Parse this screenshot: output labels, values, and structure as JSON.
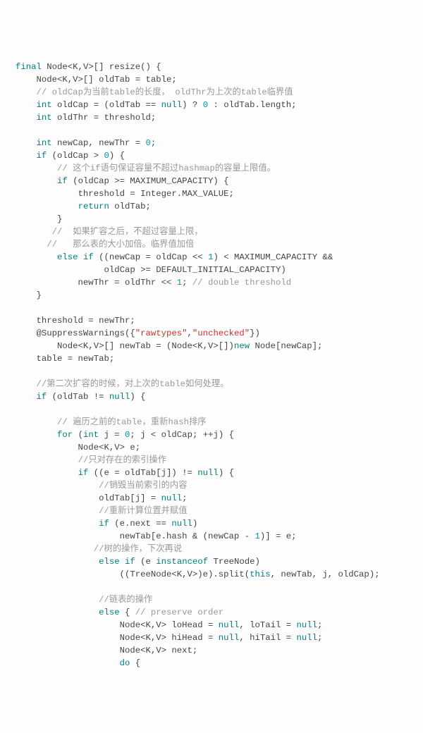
{
  "code": {
    "tokens": [
      [
        [
          "k",
          "final"
        ],
        [
          "p",
          " Node<K,V>[] resize() {"
        ]
      ],
      [
        [
          "p",
          "    Node<K,V>[] oldTab = table;"
        ]
      ],
      [
        [
          "p",
          "    "
        ],
        [
          "c",
          "// oldCap为当前table的长度， oldThr为上次的table临界值"
        ]
      ],
      [
        [
          "p",
          "    "
        ],
        [
          "k",
          "int"
        ],
        [
          "p",
          " oldCap = (oldTab == "
        ],
        [
          "b",
          "null"
        ],
        [
          "p",
          ") ? "
        ],
        [
          "n",
          "0"
        ],
        [
          "p",
          " : oldTab.length;"
        ]
      ],
      [
        [
          "p",
          "    "
        ],
        [
          "k",
          "int"
        ],
        [
          "p",
          " oldThr = threshold;"
        ]
      ],
      [
        [
          "p",
          ""
        ]
      ],
      [
        [
          "p",
          "    "
        ],
        [
          "k",
          "int"
        ],
        [
          "p",
          " newCap, newThr = "
        ],
        [
          "n",
          "0"
        ],
        [
          "p",
          ";"
        ]
      ],
      [
        [
          "p",
          "    "
        ],
        [
          "k",
          "if"
        ],
        [
          "p",
          " (oldCap > "
        ],
        [
          "n",
          "0"
        ],
        [
          "p",
          ") {"
        ]
      ],
      [
        [
          "p",
          "        "
        ],
        [
          "c",
          "// 这个if语句保证容量不超过hashmap的容量上限值。"
        ]
      ],
      [
        [
          "p",
          "        "
        ],
        [
          "k",
          "if"
        ],
        [
          "p",
          " (oldCap >= MAXIMUM_CAPACITY) {"
        ]
      ],
      [
        [
          "p",
          "            threshold = Integer.MAX_VALUE;"
        ]
      ],
      [
        [
          "p",
          "            "
        ],
        [
          "k",
          "return"
        ],
        [
          "p",
          " oldTab;"
        ]
      ],
      [
        [
          "p",
          "        }"
        ]
      ],
      [
        [
          "p",
          "       "
        ],
        [
          "c",
          "//  如果扩容之后，不超过容量上限，"
        ]
      ],
      [
        [
          "p",
          "      "
        ],
        [
          "c",
          "//   那么表的大小加倍。临界值加倍"
        ]
      ],
      [
        [
          "p",
          "        "
        ],
        [
          "k",
          "else"
        ],
        [
          "p",
          " "
        ],
        [
          "k",
          "if"
        ],
        [
          "p",
          " ((newCap = oldCap << "
        ],
        [
          "n",
          "1"
        ],
        [
          "p",
          ") < MAXIMUM_CAPACITY &&"
        ]
      ],
      [
        [
          "p",
          "                 oldCap >= DEFAULT_INITIAL_CAPACITY)"
        ]
      ],
      [
        [
          "p",
          "            newThr = oldThr << "
        ],
        [
          "n",
          "1"
        ],
        [
          "p",
          "; "
        ],
        [
          "c",
          "// double threshold"
        ]
      ],
      [
        [
          "p",
          "    }"
        ]
      ],
      [
        [
          "p",
          ""
        ]
      ],
      [
        [
          "p",
          "    threshold = newThr;"
        ]
      ],
      [
        [
          "p",
          "    @SuppressWarnings({"
        ],
        [
          "s",
          "\"rawtypes\""
        ],
        [
          "p",
          ","
        ],
        [
          "s",
          "\"unchecked\""
        ],
        [
          "p",
          "})"
        ]
      ],
      [
        [
          "p",
          "        Node<K,V>[] newTab = (Node<K,V>[])"
        ],
        [
          "k",
          "new"
        ],
        [
          "p",
          " Node[newCap];"
        ]
      ],
      [
        [
          "p",
          "    table = newTab;"
        ]
      ],
      [
        [
          "p",
          ""
        ]
      ],
      [
        [
          "p",
          "    "
        ],
        [
          "c",
          "//第二次扩容的时候，对上次的table如何处理。"
        ]
      ],
      [
        [
          "p",
          "    "
        ],
        [
          "k",
          "if"
        ],
        [
          "p",
          " (oldTab != "
        ],
        [
          "b",
          "null"
        ],
        [
          "p",
          ") {"
        ]
      ],
      [
        [
          "p",
          ""
        ]
      ],
      [
        [
          "p",
          "        "
        ],
        [
          "c",
          "// 遍历之前的table，重新hash排序"
        ]
      ],
      [
        [
          "p",
          "        "
        ],
        [
          "k",
          "for"
        ],
        [
          "p",
          " ("
        ],
        [
          "k",
          "int"
        ],
        [
          "p",
          " j = "
        ],
        [
          "n",
          "0"
        ],
        [
          "p",
          "; j < oldCap; ++j) {"
        ]
      ],
      [
        [
          "p",
          "            Node<K,V> e;"
        ]
      ],
      [
        [
          "p",
          "            "
        ],
        [
          "c",
          "//只对存在的索引操作"
        ]
      ],
      [
        [
          "p",
          "            "
        ],
        [
          "k",
          "if"
        ],
        [
          "p",
          " ((e = oldTab[j]) != "
        ],
        [
          "b",
          "null"
        ],
        [
          "p",
          ") {"
        ]
      ],
      [
        [
          "p",
          "                "
        ],
        [
          "c",
          "//销毁当前索引的内容"
        ]
      ],
      [
        [
          "p",
          "                oldTab[j] = "
        ],
        [
          "b",
          "null"
        ],
        [
          "p",
          ";"
        ]
      ],
      [
        [
          "p",
          "                "
        ],
        [
          "c",
          "//重新计算位置并赋值"
        ]
      ],
      [
        [
          "p",
          "                "
        ],
        [
          "k",
          "if"
        ],
        [
          "p",
          " (e.next == "
        ],
        [
          "b",
          "null"
        ],
        [
          "p",
          ")"
        ]
      ],
      [
        [
          "p",
          "                    newTab[e.hash & (newCap - "
        ],
        [
          "n",
          "1"
        ],
        [
          "p",
          ")] = e;"
        ]
      ],
      [
        [
          "p",
          "               "
        ],
        [
          "c",
          "//树的操作，下次再说"
        ]
      ],
      [
        [
          "p",
          "                "
        ],
        [
          "k",
          "else"
        ],
        [
          "p",
          " "
        ],
        [
          "k",
          "if"
        ],
        [
          "p",
          " (e "
        ],
        [
          "k",
          "instanceof"
        ],
        [
          "p",
          " TreeNode)"
        ]
      ],
      [
        [
          "p",
          "                    ((TreeNode<K,V>)e).split("
        ],
        [
          "k",
          "this"
        ],
        [
          "p",
          ", newTab, j, oldCap);"
        ]
      ],
      [
        [
          "p",
          ""
        ]
      ],
      [
        [
          "p",
          "                "
        ],
        [
          "c",
          "//链表的操作"
        ]
      ],
      [
        [
          "p",
          "                "
        ],
        [
          "k",
          "else"
        ],
        [
          "p",
          " { "
        ],
        [
          "c",
          "// preserve order"
        ]
      ],
      [
        [
          "p",
          "                    Node<K,V> loHead = "
        ],
        [
          "b",
          "null"
        ],
        [
          "p",
          ", loTail = "
        ],
        [
          "b",
          "null"
        ],
        [
          "p",
          ";"
        ]
      ],
      [
        [
          "p",
          "                    Node<K,V> hiHead = "
        ],
        [
          "b",
          "null"
        ],
        [
          "p",
          ", hiTail = "
        ],
        [
          "b",
          "null"
        ],
        [
          "p",
          ";"
        ]
      ],
      [
        [
          "p",
          "                    Node<K,V> next;"
        ]
      ],
      [
        [
          "p",
          "                    "
        ],
        [
          "k",
          "do"
        ],
        [
          "p",
          " {"
        ]
      ]
    ]
  }
}
